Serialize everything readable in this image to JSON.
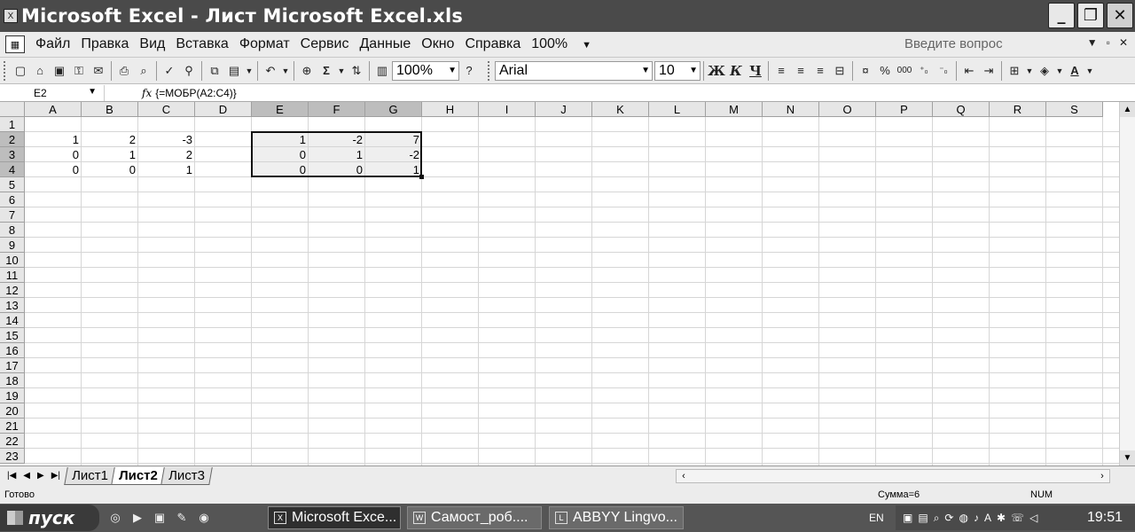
{
  "window": {
    "title": "Microsoft Excel - Лист Microsoft Excel.xls",
    "buttons": {
      "minimize": "_",
      "maximize": "❐",
      "close": "✕"
    }
  },
  "menubar": {
    "items": [
      {
        "label": "Файл"
      },
      {
        "label": "Правка"
      },
      {
        "label": "Вид"
      },
      {
        "label": "Вставка"
      },
      {
        "label": "Формат"
      },
      {
        "label": "Сервис"
      },
      {
        "label": "Данные"
      },
      {
        "label": "Окно"
      },
      {
        "label": "Справка"
      }
    ],
    "zoom": "100%",
    "help_placeholder": "Введите вопрос"
  },
  "toolbar": {
    "zoom": "100%",
    "font_name": "Arial",
    "font_size": "10",
    "bold": "Ж",
    "italic": "К",
    "underline": "Ч",
    "percent": "%",
    "thousands": "000"
  },
  "formula_bar": {
    "name_box": "E2",
    "fx": "fx",
    "formula": "{=МОБР(A2:C4)}"
  },
  "sheet": {
    "columns": [
      "A",
      "B",
      "C",
      "D",
      "E",
      "F",
      "G",
      "H",
      "I",
      "J",
      "K",
      "L",
      "M",
      "N",
      "O",
      "P",
      "Q",
      "R",
      "S"
    ],
    "selected_columns": [
      "E",
      "F",
      "G"
    ],
    "rows": [
      "1",
      "2",
      "3",
      "4",
      "5",
      "6",
      "7",
      "8",
      "9",
      "10",
      "11",
      "12",
      "13",
      "14",
      "15",
      "16",
      "17",
      "18",
      "19",
      "20",
      "21",
      "22",
      "23"
    ],
    "selected_rows": [
      "2",
      "3",
      "4"
    ],
    "cells": [
      {
        "ref": "A2",
        "value": "1"
      },
      {
        "ref": "B2",
        "value": "2"
      },
      {
        "ref": "C2",
        "value": "-3"
      },
      {
        "ref": "A3",
        "value": "0"
      },
      {
        "ref": "B3",
        "value": "1"
      },
      {
        "ref": "C3",
        "value": "2"
      },
      {
        "ref": "A4",
        "value": "0"
      },
      {
        "ref": "B4",
        "value": "0"
      },
      {
        "ref": "C4",
        "value": "1"
      },
      {
        "ref": "E2",
        "value": "1"
      },
      {
        "ref": "F2",
        "value": "-2"
      },
      {
        "ref": "G2",
        "value": "7"
      },
      {
        "ref": "E3",
        "value": "0"
      },
      {
        "ref": "F3",
        "value": "1"
      },
      {
        "ref": "G3",
        "value": "-2"
      },
      {
        "ref": "E4",
        "value": "0"
      },
      {
        "ref": "F4",
        "value": "0"
      },
      {
        "ref": "G4",
        "value": "1"
      }
    ],
    "selection": "E2:G4"
  },
  "sheet_tabs": [
    {
      "label": "Лист1",
      "active": false
    },
    {
      "label": "Лист2",
      "active": true
    },
    {
      "label": "Лист3",
      "active": false
    }
  ],
  "statusbar": {
    "ready": "Готово",
    "sum": "Сумма=6",
    "num": "NUM"
  },
  "taskbar": {
    "start": "пуск",
    "items": [
      {
        "label": "Microsoft Exce...",
        "active": true
      },
      {
        "label": "Самост_роб....",
        "active": false
      },
      {
        "label": "ABBYY Lingvo...",
        "active": false
      }
    ],
    "lang": "EN",
    "clock": "19:51"
  }
}
